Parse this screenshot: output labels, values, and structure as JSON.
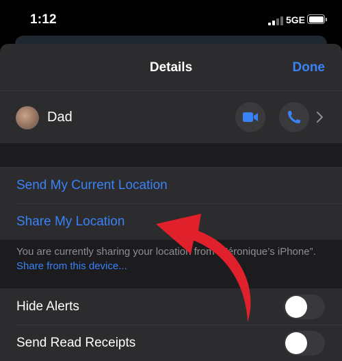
{
  "status_bar": {
    "time": "1:12",
    "network": "5GE",
    "icons": [
      "signal-icon",
      "battery-icon"
    ]
  },
  "nav": {
    "title": "Details",
    "done_label": "Done"
  },
  "contact": {
    "name": "Dad",
    "actions": [
      "video-call-icon",
      "phone-call-icon",
      "chevron-right-icon"
    ]
  },
  "location": {
    "send_current": "Send My Current Location",
    "share": "Share My Location",
    "info_text": "You are currently sharing your location from “Véronique’s iPhone”.",
    "info_link": "Share from this device..."
  },
  "settings": {
    "hide_alerts": {
      "label": "Hide Alerts",
      "on": false
    },
    "read_receipts": {
      "label": "Send Read Receipts",
      "on": false
    }
  },
  "colors": {
    "accent": "#3a82f7",
    "annotation_arrow": "#e0202a",
    "sheet_bg": "#1c1c1e",
    "row_bg": "#2c2c2e"
  }
}
